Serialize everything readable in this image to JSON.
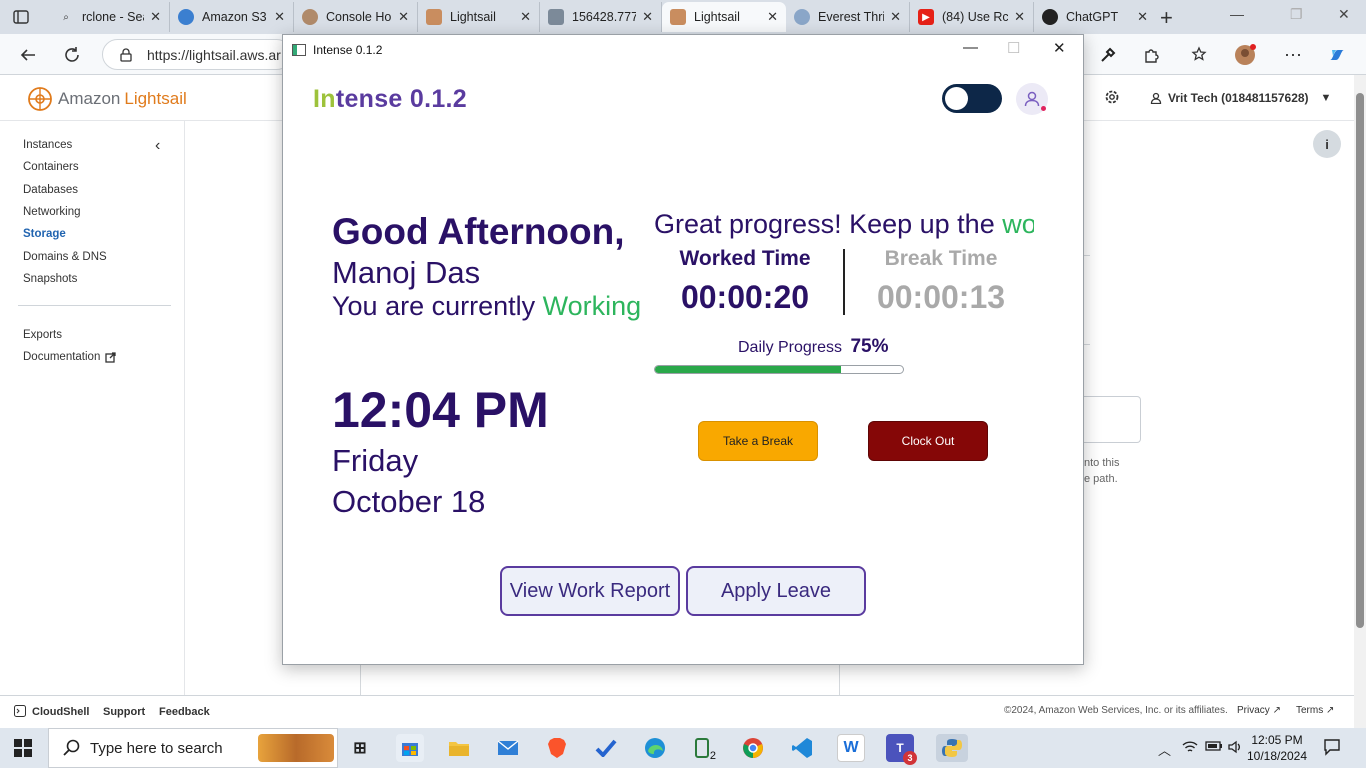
{
  "browser": {
    "tabs": [
      {
        "label": "rclone - Sea",
        "favicon": "search-favicon"
      },
      {
        "label": "Amazon S3",
        "favicon": "s3-favicon"
      },
      {
        "label": "Console Ho",
        "favicon": "aws-console-favicon"
      },
      {
        "label": "Lightsail",
        "favicon": "lightsail-favicon"
      },
      {
        "label": "156428.777",
        "favicon": "document-favicon"
      },
      {
        "label": "Lightsail",
        "favicon": "lightsail-favicon",
        "active": true
      },
      {
        "label": "Everest Thri",
        "favicon": "cloud-favicon"
      },
      {
        "label": "(84) Use Rc",
        "favicon": "youtube-favicon"
      },
      {
        "label": "ChatGPT",
        "favicon": "chatgpt-favicon"
      }
    ],
    "url": "https://lightsail.aws.ar"
  },
  "lightsail": {
    "logo_prefix": "Amazon",
    "logo_brand": "Lightsail",
    "account": "Vrit Tech (018481157628)",
    "sidebar": {
      "items": [
        "Instances",
        "Containers",
        "Databases",
        "Networking",
        "Storage",
        "Domains & DNS",
        "Snapshots"
      ],
      "active": "Storage",
      "extra": [
        "Exports",
        "Documentation"
      ]
    },
    "partial_text_1": "nto this",
    "partial_text_2": "e path.",
    "footer": {
      "cloudshell": "CloudShell",
      "support": "Support",
      "feedback": "Feedback",
      "copyright": "©2024, Amazon Web Services, Inc. or its affiliates.",
      "privacy": "Privacy",
      "terms": "Terms"
    }
  },
  "app": {
    "window_title": "Intense 0.1.2",
    "logo_accent": "In",
    "logo_rest": "tense 0.1.2",
    "greeting": "Good Afternoon,",
    "user_name": "Manoj Das",
    "status_prefix": "You are currently",
    "status_value": "Working",
    "time": "12:04 PM",
    "day": "Friday",
    "date": "October 18",
    "marquee_text": "Great progress! Keep up the ",
    "marquee_highlight": "wo",
    "worked_label": "Worked Time",
    "worked_value": "00:00:20",
    "break_label": "Break Time",
    "break_value": "00:00:13",
    "progress_label": "Daily Progress",
    "progress_percent_text": "75%",
    "progress_fraction": 0.75,
    "take_break": "Take a Break",
    "clock_out": "Clock Out",
    "view_report": "View Work Report",
    "apply_leave": "Apply Leave",
    "colors": {
      "primary": "#2a1166",
      "accent_green": "#2db55d",
      "break_button": "#f9a800",
      "clockout_button": "#850707",
      "logo_purple": "#5a3b9f",
      "logo_green": "#9dc23b"
    }
  },
  "taskbar": {
    "search_placeholder": "Type here to search",
    "time": "12:05 PM",
    "date": "10/18/2024",
    "badges": {
      "phone_link": "2",
      "teams": "3"
    }
  }
}
